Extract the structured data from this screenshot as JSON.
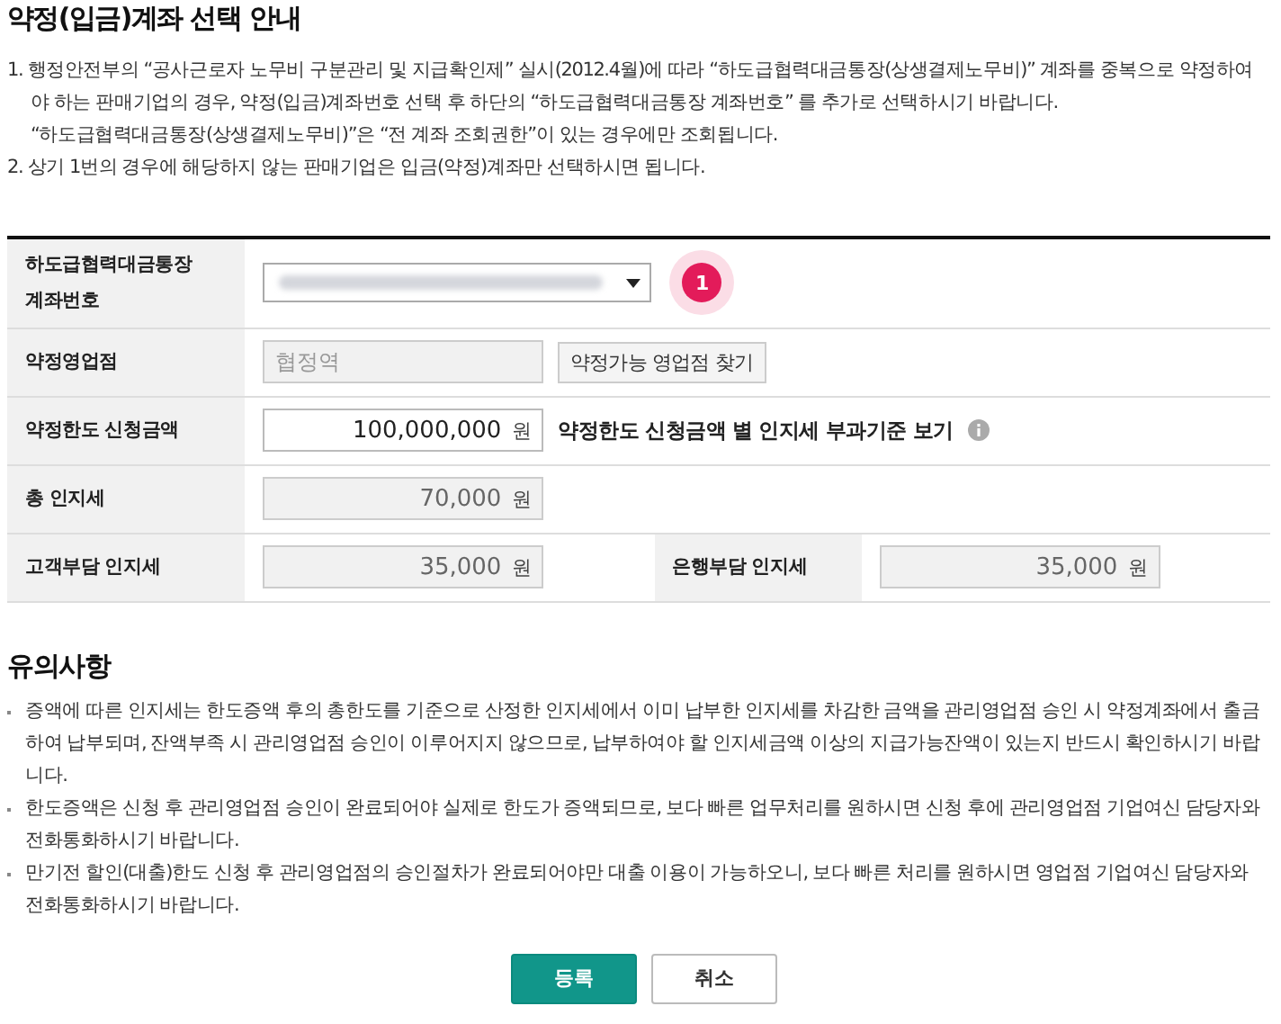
{
  "title": "약정(입금)계좌 선택 안내",
  "intro": [
    {
      "text": "1. 행정안전부의 “공사근로자 노무비 구분관리 및 지급확인제” 실시(2012.4월)에 따라 “하도급협력대금통장(상생결제노무비)” 계좌를 중복으로 약정하여야 하는 판매기업의 경우, 약정(입금)계좌번호 선택 후 하단의 “하도급협력대금통장 계좌번호” 를 추가로 선택하시기 바랍니다.",
      "sub": "“하도급협력대금통장(상생결제노무비)”은 “전 계좌 조회권한”이 있는 경우에만 조회됩니다."
    },
    {
      "text": "2. 상기 1번의 경우에 해당하지 않는 판매기업은 입금(약정)계좌만 선택하시면 됩니다."
    }
  ],
  "table": {
    "rows": [
      {
        "cells": [
          {
            "label": "하도급협력대금통장 계좌번호",
            "controls": [
              {
                "kind": "select",
                "badge": "1"
              }
            ]
          }
        ]
      },
      {
        "cells": [
          {
            "label": "약정영업점",
            "controls": [
              {
                "kind": "field",
                "readonly": true,
                "placeholder": "협정역"
              },
              {
                "kind": "button",
                "label": "약정가능 영업점 찾기"
              }
            ]
          }
        ]
      },
      {
        "cells": [
          {
            "label": "약정한도 신청금액",
            "controls": [
              {
                "kind": "field",
                "readonly": false,
                "value": "100,000,000",
                "unit": "원"
              },
              {
                "kind": "link",
                "label": "약정한도 신청금액 별 인지세 부과기준 보기"
              }
            ]
          }
        ]
      },
      {
        "cells": [
          {
            "label": "총 인지세",
            "controls": [
              {
                "kind": "field",
                "readonly": true,
                "value": "70,000",
                "unit": "원"
              }
            ]
          }
        ]
      },
      {
        "cells": [
          {
            "label": "고객부담 인지세",
            "controls": [
              {
                "kind": "field",
                "readonly": true,
                "value": "35,000",
                "unit": "원"
              }
            ]
          },
          {
            "label": "은행부담 인지세",
            "controls": [
              {
                "kind": "field",
                "readonly": true,
                "value": "35,000",
                "unit": "원"
              }
            ]
          }
        ]
      }
    ]
  },
  "notes": {
    "title": "유의사항",
    "items": [
      "증액에 따른 인지세는 한도증액 후의 총한도를 기준으로 산정한 인지세에서 이미 납부한 인지세를 차감한 금액을 관리영업점 승인 시 약정계좌에서 출금하여 납부되며, 잔액부족 시 관리영업점 승인이 이루어지지 않으므로, 납부하여야 할 인지세금액 이상의 지급가능잔액이 있는지 반드시 확인하시기 바랍니다.",
      "한도증액은 신청 후 관리영업점 승인이 완료되어야 실제로 한도가 증액되므로, 보다 빠른 업무처리를 원하시면 신청 후에 관리영업점 기업여신 담당자와 전화통화하시기 바랍니다.",
      "만기전 할인(대출)한도 신청 후 관리영업점의 승인절차가 완료되어야만 대출 이용이 가능하오니, 보다 빠른 처리를 원하시면 영업점 기업여신 담당자와 전화통화하시기 바랍니다."
    ]
  },
  "buttons": [
    {
      "label": "등록",
      "kind": "primary"
    },
    {
      "label": "취소",
      "kind": "secondary"
    }
  ]
}
